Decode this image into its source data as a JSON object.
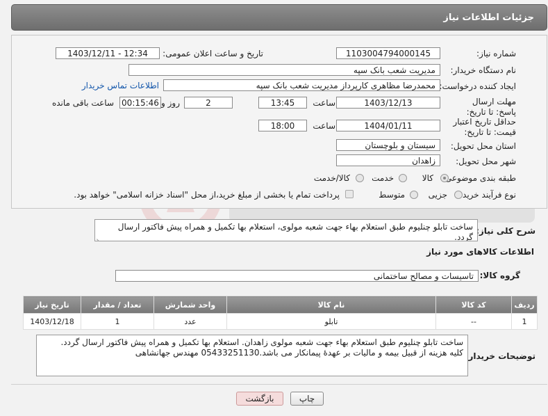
{
  "page": {
    "title": "جزئیات اطلاعات نیاز"
  },
  "form": {
    "need_number_label": "شماره نیاز:",
    "need_number": "1103004794000145",
    "announce_label": "تاریخ و ساعت اعلان عمومی:",
    "announce_value": "1403/12/11 - 12:34",
    "buyer_org_label": "نام دستگاه خریدار:",
    "buyer_org": "مدیریت شعب بانک سپه",
    "creator_label": "ایجاد کننده درخواست:",
    "creator": "محمدرضا مظاهری کارپرداز مدیریت شعب بانک سپه",
    "contact_link": "اطلاعات تماس خریدار",
    "reply_deadline_label": "مهلت ارسال پاسخ: تا تاریخ:",
    "reply_date": "1403/12/13",
    "time_label": "ساعت",
    "reply_time": "13:45",
    "days": "2",
    "days_label": "روز و",
    "remaining_time": "00:15:46",
    "remaining_label": "ساعت باقی مانده",
    "price_validity_label": "حداقل تاریخ اعتبار قیمت: تا تاریخ:",
    "price_date": "1404/01/11",
    "price_time": "18:00",
    "province_label": "استان محل تحویل:",
    "province": "سیستان و بلوچستان",
    "city_label": "شهر محل تحویل:",
    "city": "زاهدان",
    "category_label": "طبقه بندی موضوعی:",
    "category_options": [
      "کالا",
      "خدمت",
      "کالا/خدمت"
    ],
    "category_selected": "کالا",
    "process_label": "نوع فرآیند خرید :",
    "process_options": [
      "جزیی",
      "متوسط"
    ],
    "process_selected": "جزیی",
    "payment_note": "پرداخت تمام یا بخشی از مبلغ خرید،از محل \"اسناد خزانه اسلامی\" خواهد بود."
  },
  "description": {
    "label": "شرح کلی نیاز:",
    "text": "ساخت تابلو چنلیوم  طبق استعلام بهاء جهت شعبه مولوی، استعلام بها تکمیل و همراه پیش فاکتور ارسال گردد."
  },
  "goods": {
    "section_title": "اطلاعات کالاهای مورد نیاز",
    "group_label": "گروه کالا:",
    "group_value": "تاسیسات و مصالح ساختمانی",
    "columns": [
      "ردیف",
      "کد کالا",
      "نام کالا",
      "واحد شمارش",
      "تعداد / مقدار",
      "تاریخ نیاز"
    ],
    "rows": [
      {
        "row": "1",
        "code": "--",
        "name": "تابلو",
        "unit": "عدد",
        "qty": "1",
        "date": "1403/12/18"
      }
    ]
  },
  "buyer_notes": {
    "label": "توضیحات خریدار:",
    "line1": "ساخت تابلو چنلیوم  طبق استعلام بهاء جهت شعبه مولوی زاهدان. استعلام بها تکمیل و همراه پیش فاکتور ارسال گردد.",
    "line2": "کلیه هزینه  از قبیل بیمه و مالیات بر عهدهٔ پیمانکار می باشد.05433251130 مهندس جهانشاهی"
  },
  "buttons": {
    "print": "چاپ",
    "back": "بازگشت"
  },
  "colors": {
    "header": "#7a7a7a",
    "link": "#1155aa",
    "back_button": "#f5dcdc"
  }
}
